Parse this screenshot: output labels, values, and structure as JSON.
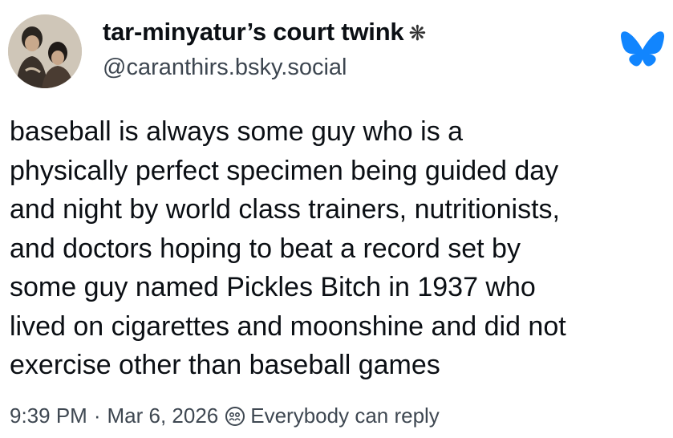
{
  "post": {
    "display_name": "tar-minyatur’s court twink",
    "name_suffix_glyph": "❋",
    "handle": "@caranthirs.bsky.social",
    "body_lines": [
      "baseball is always some guy who is a",
      "physically perfect specimen being guided day",
      "and night by world class trainers, nutritionists,",
      "and doctors hoping to beat a record set by",
      "some guy named Pickles Bitch in 1937 who",
      "lived on cigarettes and moonshine and did not",
      "exercise other than baseball games"
    ],
    "time": "9:39 PM",
    "separator": "·",
    "date": "Mar 6, 2026",
    "reply_setting": "Everybody can reply"
  },
  "icons": {
    "avatar": "avatar-image",
    "brand": "bluesky-butterfly-icon",
    "reply": "reply-setting-icon"
  },
  "colors": {
    "brand_blue": "#1185fe",
    "text": "#0b0f14",
    "muted": "#3f4852"
  }
}
